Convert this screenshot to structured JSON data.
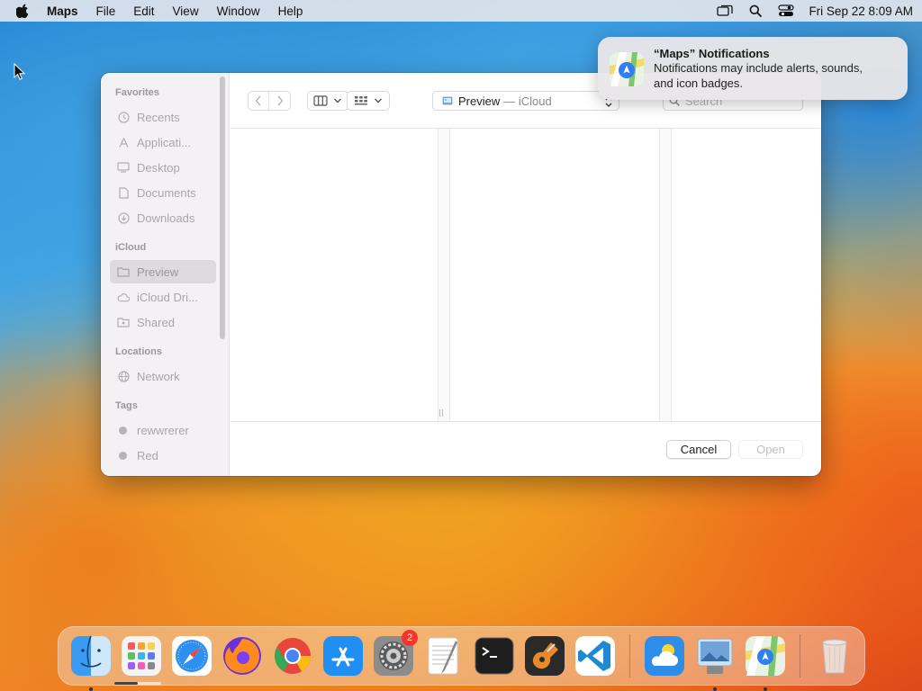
{
  "menubar": {
    "app_name": "Maps",
    "menus": [
      "File",
      "Edit",
      "View",
      "Window",
      "Help"
    ],
    "icons": [
      "apple-icon",
      "screen-mirroring-icon",
      "spotlight-search-icon",
      "control-center-icon"
    ],
    "clock": "Fri Sep 22  8:09 AM"
  },
  "dialog": {
    "sidebar": {
      "favorites_heading": "Favorites",
      "favorites": [
        {
          "label": "Recents",
          "icon": "clock-icon"
        },
        {
          "label": "Applicati...",
          "icon": "applications-icon"
        },
        {
          "label": "Desktop",
          "icon": "desktop-icon"
        },
        {
          "label": "Documents",
          "icon": "document-icon"
        },
        {
          "label": "Downloads",
          "icon": "download-icon"
        }
      ],
      "icloud_heading": "iCloud",
      "icloud": [
        {
          "label": "Preview",
          "icon": "folder-icon",
          "selected": true
        },
        {
          "label": "iCloud Dri...",
          "icon": "cloud-icon"
        },
        {
          "label": "Shared",
          "icon": "shared-folder-icon"
        }
      ],
      "locations_heading": "Locations",
      "locations": [
        {
          "label": "Network",
          "icon": "globe-icon"
        }
      ],
      "tags_heading": "Tags",
      "tags": [
        {
          "label": "rewwrerer",
          "color": "#b6b4b6"
        },
        {
          "label": "Red",
          "color": "#b6b4b6"
        }
      ]
    },
    "toolbar": {
      "location_name": "Preview",
      "location_suffix": "— iCloud",
      "search_placeholder": "Search"
    },
    "buttons": {
      "cancel": "Cancel",
      "open": "Open"
    }
  },
  "notification": {
    "title": "“Maps” Notifications",
    "body_line1": "Notifications may include alerts, sounds,",
    "body_line2": "and icon badges."
  },
  "dock": {
    "apps": [
      "Finder",
      "Launchpad",
      "Safari",
      "Firefox",
      "Chrome",
      "App Store",
      "System Settings",
      "TextEdit",
      "Terminal",
      "GarageBand",
      "Visual Studio Code"
    ],
    "recent": [
      "Weather",
      "Preview",
      "Maps"
    ],
    "system_settings_badge": "2",
    "trash": "Trash",
    "progress_fraction": 0.5
  },
  "colors": {
    "accent": "#0a84ff",
    "badge": "#f2362c"
  }
}
